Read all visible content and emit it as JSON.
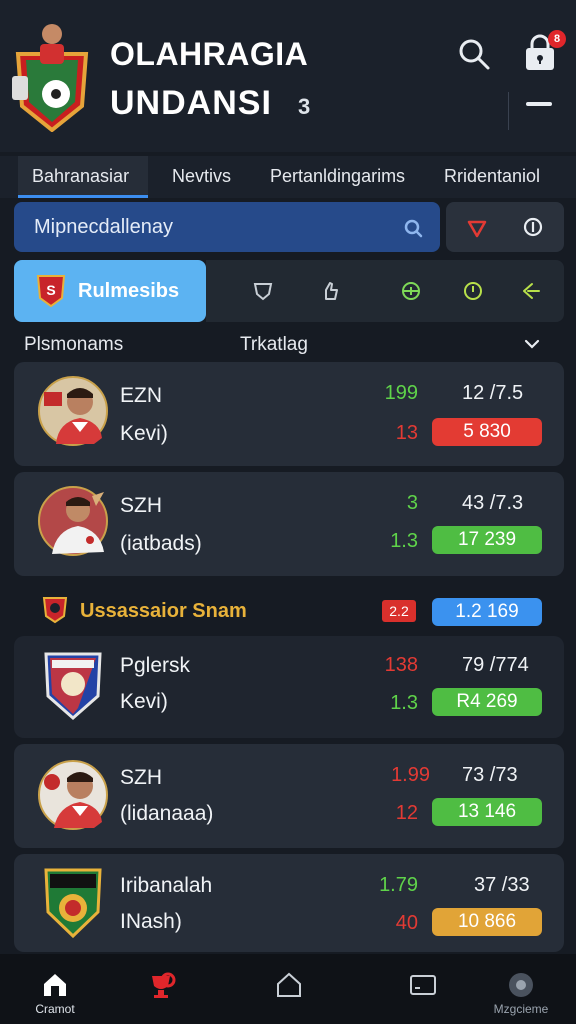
{
  "header": {
    "title_line1": "OLAHRAGIA",
    "title_line2": "UNDANSI",
    "title_badge": "3",
    "lock_badge": "8"
  },
  "tabs": [
    {
      "label": "Bahranasiar",
      "active": true
    },
    {
      "label": "Nevtivs",
      "active": false
    },
    {
      "label": "Pertanldingarims",
      "active": false
    },
    {
      "label": "Rridentaniol",
      "active": false
    }
  ],
  "search": {
    "value": "Mipnecdallenay"
  },
  "categories": {
    "active_label": "Rulmesibs",
    "icons": [
      "shield-outline-icon",
      "thumb-icon",
      "target-icon",
      "clock-icon",
      "swap-icon"
    ]
  },
  "section": {
    "left_label": "Plsmonams",
    "mid_label": "Trkatlag"
  },
  "matches": [
    {
      "name": "EZN",
      "sub": "Kevi)",
      "n1": "199",
      "n1_color": "green",
      "n2": "13",
      "n2_color": "red",
      "pair": "12 /7.5",
      "pill": "5 830",
      "pill_color": "red"
    },
    {
      "name": "SZH",
      "sub": "(iatbads)",
      "n1": "3",
      "n1_color": "green",
      "n2": "1.3",
      "n2_color": "green",
      "pair": "43 /7.3",
      "pill": "17 239",
      "pill_color": "green"
    }
  ],
  "group": {
    "title": "Ussassaior Snam",
    "badge": "2.2",
    "pill": "1.2 169",
    "pill_color": "blue"
  },
  "group_matches": [
    {
      "name": "Pglersk",
      "sub": "Kevi)",
      "n1": "138",
      "n1_color": "red",
      "n2": "1.3",
      "n2_color": "green",
      "pair": "79 /774",
      "pill": "R4 269",
      "pill_color": "green"
    },
    {
      "name": "SZH",
      "sub": "(lidanaaa)",
      "n1": "1.99",
      "n1_color": "red",
      "n2": "12",
      "n2_color": "red",
      "pair": "73 /73",
      "pill": "13 146",
      "pill_color": "green"
    },
    {
      "name": "Iribanalah",
      "sub": "INash)",
      "n1": "1.79",
      "n1_color": "green",
      "n2": "40",
      "n2_color": "red",
      "pair": "37 /33",
      "pill": "10 866",
      "pill_color": "orange"
    }
  ],
  "bottom_nav": [
    {
      "label": "Cramot",
      "icon": "home-icon"
    },
    {
      "label": "",
      "icon": "trophy-icon"
    },
    {
      "label": "",
      "icon": "house-outline-icon"
    },
    {
      "label": "",
      "icon": "tablet-icon"
    },
    {
      "label": "Mzgcieme",
      "icon": "profile-icon"
    }
  ],
  "colors": {
    "accent_blue": "#3c8ef0",
    "green": "#5fd34a",
    "red": "#e33a34",
    "orange": "#e1a437",
    "gold": "#e8b23a"
  }
}
